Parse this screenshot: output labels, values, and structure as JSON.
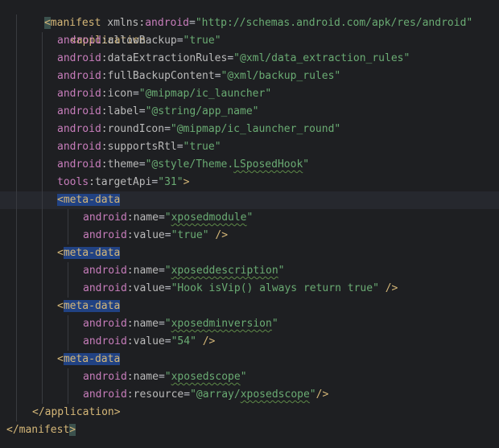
{
  "editor": {
    "language": "XML",
    "colors": {
      "background": "#1e1f22",
      "current_line": "#26282e",
      "tag": "#d5b778",
      "namespace_prefix": "#c77dbb",
      "attribute": "#bababa",
      "string_value": "#6aab73",
      "tag_highlight": "#214283",
      "bracket_highlight": "#3b514d",
      "typo_underline": "#5e8a48"
    },
    "tokens": {
      "open": "<",
      "close_open": "</",
      "self_close": " />",
      "self_close_tight": "/>",
      "gt": ">",
      "eq": "=",
      "colon": ":",
      "quote": "\""
    }
  },
  "lines": {
    "l1": {
      "tag": "manifest",
      "attr": "xmlns",
      "ns": "android",
      "value": "http://schemas.android.com/apk/res/android"
    },
    "l2": {
      "tag": "application"
    },
    "l3": {
      "ns": "android",
      "attr": "allowBackup",
      "value": "true"
    },
    "l4": {
      "ns": "android",
      "attr": "dataExtractionRules",
      "value": "@xml/data_extraction_rules"
    },
    "l5": {
      "ns": "android",
      "attr": "fullBackupContent",
      "value": "@xml/backup_rules"
    },
    "l6": {
      "ns": "android",
      "attr": "icon",
      "value": "@mipmap/ic_launcher"
    },
    "l7": {
      "ns": "android",
      "attr": "label",
      "value": "@string/app_name"
    },
    "l8": {
      "ns": "android",
      "attr": "roundIcon",
      "value": "@mipmap/ic_launcher_round"
    },
    "l9": {
      "ns": "android",
      "attr": "supportsRtl",
      "value": "true"
    },
    "l10": {
      "ns": "android",
      "attr": "theme",
      "value_prefix": "@style/Theme.",
      "value_word": "LSposedHook"
    },
    "l11": {
      "ns": "tools",
      "attr": "targetApi",
      "value": "31"
    },
    "l12": {
      "tag": "meta-data"
    },
    "l13": {
      "ns": "android",
      "attr": "name",
      "value": "xposedmodule"
    },
    "l14": {
      "ns": "android",
      "attr": "value",
      "value": "true"
    },
    "l15": {
      "tag": "meta-data"
    },
    "l16": {
      "ns": "android",
      "attr": "name",
      "value": "xposeddescription"
    },
    "l17": {
      "ns": "android",
      "attr": "value",
      "value": "Hook isVip() always return true"
    },
    "l18": {
      "tag": "meta-data"
    },
    "l19": {
      "ns": "android",
      "attr": "name",
      "value": "xposedminversion"
    },
    "l20": {
      "ns": "android",
      "attr": "value",
      "value": "54"
    },
    "l21": {
      "tag": "meta-data"
    },
    "l22": {
      "ns": "android",
      "attr": "name",
      "value": "xposedscope"
    },
    "l23": {
      "ns": "android",
      "attr": "resource",
      "value_prefix": "@array/",
      "value_word": "xposedscope"
    },
    "l24": {
      "tag": "application"
    },
    "l25": {
      "tag": "manifest"
    }
  }
}
